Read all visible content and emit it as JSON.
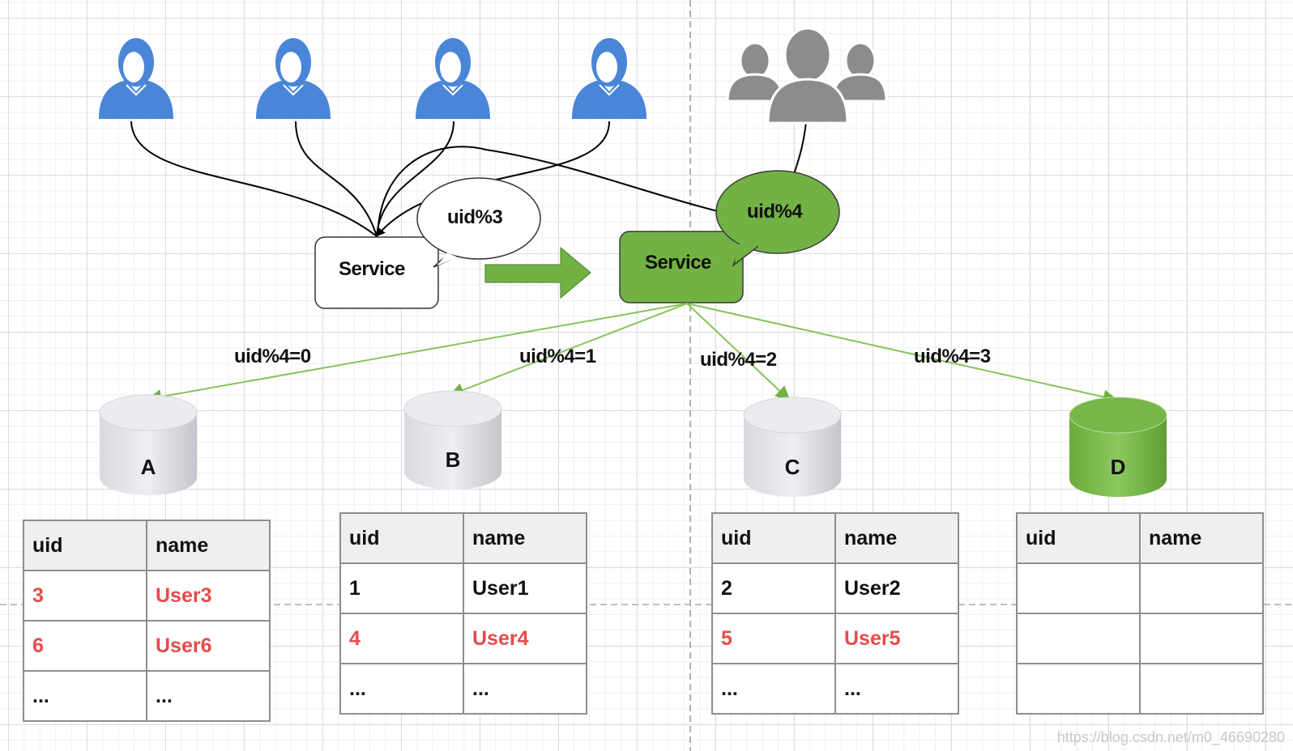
{
  "diagram": {
    "colors": {
      "user_blue": "#4a86d8",
      "group_gray": "#8c8c8c",
      "green": "#72b244",
      "green_line": "#86c45a",
      "red_text": "#e84a4a"
    },
    "users": [
      {
        "icon": "user-icon"
      },
      {
        "icon": "user-icon"
      },
      {
        "icon": "user-icon"
      },
      {
        "icon": "user-icon"
      }
    ],
    "user_group": {
      "icon": "users-group-icon"
    },
    "old_service": {
      "label": "Service",
      "bubble": "uid%3"
    },
    "new_service": {
      "label": "Service",
      "bubble": "uid%4"
    },
    "transition_arrow": {
      "icon": "arrow-right-icon"
    },
    "routes": [
      {
        "label": "uid%4=0",
        "target": "A"
      },
      {
        "label": "uid%4=1",
        "target": "B"
      },
      {
        "label": "uid%4=2",
        "target": "C"
      },
      {
        "label": "uid%4=3",
        "target": "D"
      }
    ],
    "databases": [
      {
        "name": "A",
        "highlight": false
      },
      {
        "name": "B",
        "highlight": false
      },
      {
        "name": "C",
        "highlight": false
      },
      {
        "name": "D",
        "highlight": true
      }
    ],
    "tables": [
      {
        "headers": [
          "uid",
          "name"
        ],
        "rows": [
          {
            "uid": "3",
            "name": "User3",
            "red": true
          },
          {
            "uid": "6",
            "name": "User6",
            "red": true
          },
          {
            "uid": "...",
            "name": "...",
            "red": false
          }
        ]
      },
      {
        "headers": [
          "uid",
          "name"
        ],
        "rows": [
          {
            "uid": "1",
            "name": "User1",
            "red": false
          },
          {
            "uid": "4",
            "name": "User4",
            "red": true
          },
          {
            "uid": "...",
            "name": "...",
            "red": false
          }
        ]
      },
      {
        "headers": [
          "uid",
          "name"
        ],
        "rows": [
          {
            "uid": "2",
            "name": "User2",
            "red": false
          },
          {
            "uid": "5",
            "name": "User5",
            "red": true
          },
          {
            "uid": "...",
            "name": "...",
            "red": false
          }
        ]
      },
      {
        "headers": [
          "uid",
          "name"
        ],
        "rows": [
          {
            "uid": "",
            "name": "",
            "red": false
          },
          {
            "uid": "",
            "name": "",
            "red": false
          },
          {
            "uid": "",
            "name": "",
            "red": false
          }
        ]
      }
    ]
  },
  "watermark": "https://blog.csdn.net/m0_46690280"
}
